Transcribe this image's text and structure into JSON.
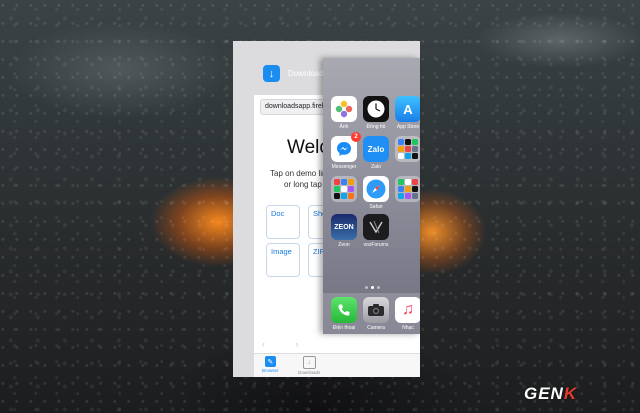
{
  "downloads_card": {
    "app_name": "Downloads",
    "url": "downloadsapp.fireba",
    "welcome_text": "Welco",
    "instruction_line1": "Tap on demo links",
    "instruction_line2": "or long tap to",
    "tiles": [
      "Doc",
      "She",
      "Image",
      "ZIP"
    ],
    "tabs": [
      "Browser",
      "Downloads"
    ]
  },
  "home_card": {
    "rows": [
      [
        {
          "label": "Ảnh",
          "icon": "photos-icon"
        },
        {
          "label": "Đồng hồ",
          "icon": "clock-icon"
        },
        {
          "label": "App Store",
          "icon": "appstore-icon"
        }
      ],
      [
        {
          "label": "Messenger",
          "icon": "messenger-icon",
          "badge": "2"
        },
        {
          "label": "Zalo",
          "icon": "zalo-icon"
        },
        {
          "label": "",
          "icon": "folder-icon"
        }
      ],
      [
        {
          "label": "",
          "icon": "folder-icon"
        },
        {
          "label": "Safari",
          "icon": "safari-icon"
        },
        {
          "label": "",
          "icon": "folder-icon"
        }
      ],
      [
        {
          "label": "Zeon",
          "icon": "zeon-icon"
        },
        {
          "label": "vozForums",
          "icon": "voz-icon"
        }
      ]
    ],
    "dock": [
      {
        "label": "Điện thoại",
        "icon": "phone-icon"
      },
      {
        "label": "Camera",
        "icon": "camera-icon"
      },
      {
        "label": "Nhạc",
        "icon": "music-icon"
      }
    ],
    "current_page": 2,
    "page_count": 3
  },
  "watermark": {
    "prefix": "GEN",
    "suffix": "K"
  },
  "colors": {
    "accent_blue": "#1b8cf0",
    "badge_red": "#ff3b30",
    "brand_red": "#e53b2f"
  }
}
